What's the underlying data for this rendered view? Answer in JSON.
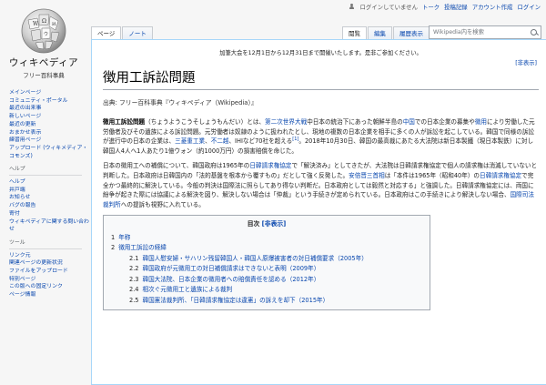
{
  "personal": {
    "not_logged_in": "ログインしていません",
    "talk": "トーク",
    "contributions": "投稿記録",
    "create_account": "アカウント作成",
    "login": "ログイン"
  },
  "logo": {
    "wordmark": "ウィキペディア",
    "tagline": "フリー百科事典"
  },
  "tabs_left": [
    {
      "label": "ページ",
      "selected": true
    },
    {
      "label": "ノート",
      "selected": false
    }
  ],
  "tabs_right": [
    {
      "label": "閲覧",
      "selected": true
    },
    {
      "label": "編集",
      "selected": false
    },
    {
      "label": "履歴表示",
      "selected": false
    }
  ],
  "search": {
    "placeholder": "Wikipedia内を検索"
  },
  "sidebar": {
    "main_links": [
      "メインページ",
      "コミュニティ・ポータル",
      "最近の出来事",
      "新しいページ",
      "最近の更新",
      "おまかせ表示",
      "練習用ページ",
      "アップロード (ウィキメディア・コモンズ)"
    ],
    "help_head": "ヘルプ",
    "help_links": [
      "ヘルプ",
      "井戸端",
      "お知らせ",
      "バグの報告",
      "寄付",
      "ウィキペディアに関する問い合わせ"
    ],
    "tools_head": "ツール",
    "tools_links": [
      "リンク元",
      "関連ページの更新状況",
      "ファイルをアップロード",
      "特別ページ",
      "この版への固定リンク",
      "ページ情報"
    ]
  },
  "notice": {
    "text": "加筆大会を12月1日から12月31日まで開催いたします。是非ご参加ください。",
    "hide": "[非表示]"
  },
  "title": "徴用工訴訟問題",
  "site_sub": "出典: フリー百科事典『ウィキペディア（Wikipedia）』",
  "para1": {
    "term": "徴用工訴訟問題",
    "reading": "（ちょうようこうそしょうもんだい）とは、",
    "link_ww2": "第二次世界大戦",
    "t1": "中日本の統治下にあった朝鮮半島の",
    "link_china": "中国",
    "t2": "での日本企業の募集や",
    "link_recruit": "徴用",
    "t3": "により労働した元労働者及びその遺族による訴訟問題。元労働者は奴隷のように扱われたとし、現地の複数の日本企業を相手に多くの人が訴訟を起こしている。韓国で同様の訴訟が進行中の日本の企業は、",
    "link_mitsubishi": "三菱重工業",
    "t4": "、",
    "link_fujikoshi": "不二越",
    "t5": "、IHIなど70社を超える",
    "ref": "[1]",
    "t6": "。2018年10月30日、韓国の最高裁にあたる大法院は新日本製鐵（現日本製鉄）に対し韓国人4人へ1人あたり1億ウォン（約1000万円）の損害賠償を命じた。"
  },
  "para2": {
    "t1": "日本の徴用工への補償について、韓国政府は1965年の",
    "link_treaty": "日韓請求権協定",
    "t2": "で「解決済み」としてきたが、大法院は日韓請求権協定で個人の請求権は消滅していないと判断した。日本政府は日韓国内の「法的基盤を根本から覆すもの」だとして強く反発した。",
    "link_abe": "安倍晋三首相",
    "t3": "は「本件は1965年（昭和40年）の",
    "link_treaty2": "日韓請求権協定",
    "t4": "で完全かつ最終的に解決している。今般の判決は国際法に照らしてあり得ない判断だ。日本政府としては毅然と対応する」と強調した。日韓請求権協定には、両国に紛争が起きた際には協議による解決を図り、解決しない場合は「仲裁」という手続きが定められている。日本政府はこの手続きにより解決しない場合、",
    "link_icj": "国際司法裁判所",
    "t5": "への提訴も視野に入れている。"
  },
  "toc": {
    "title": "目次",
    "toggle": "[非表示]",
    "items": [
      {
        "num": "1",
        "text": "年称",
        "level": 1
      },
      {
        "num": "2",
        "text": "徴用工訴訟の経緯",
        "level": 1
      },
      {
        "num": "2.1",
        "text": "韓国人慰安婦・サハリン残留韓国人・韓国人原爆被害者の対日補償要求（2005年）",
        "level": 2
      },
      {
        "num": "2.2",
        "text": "韓国政府が元徴用工の対日補償請求はできないと表明（2009年）",
        "level": 2
      },
      {
        "num": "2.3",
        "text": "韓国大法院、日本企業の徴用者への賠償責任を認める（2012年）",
        "level": 2
      },
      {
        "num": "2.4",
        "text": "相次ぐ元徴用工と遺族による裁判",
        "level": 2
      },
      {
        "num": "2.5",
        "text": "韓国憲法裁判所、「日韓請求権協定は違憲」の訴えを却下（2015年）",
        "level": 2
      }
    ]
  }
}
